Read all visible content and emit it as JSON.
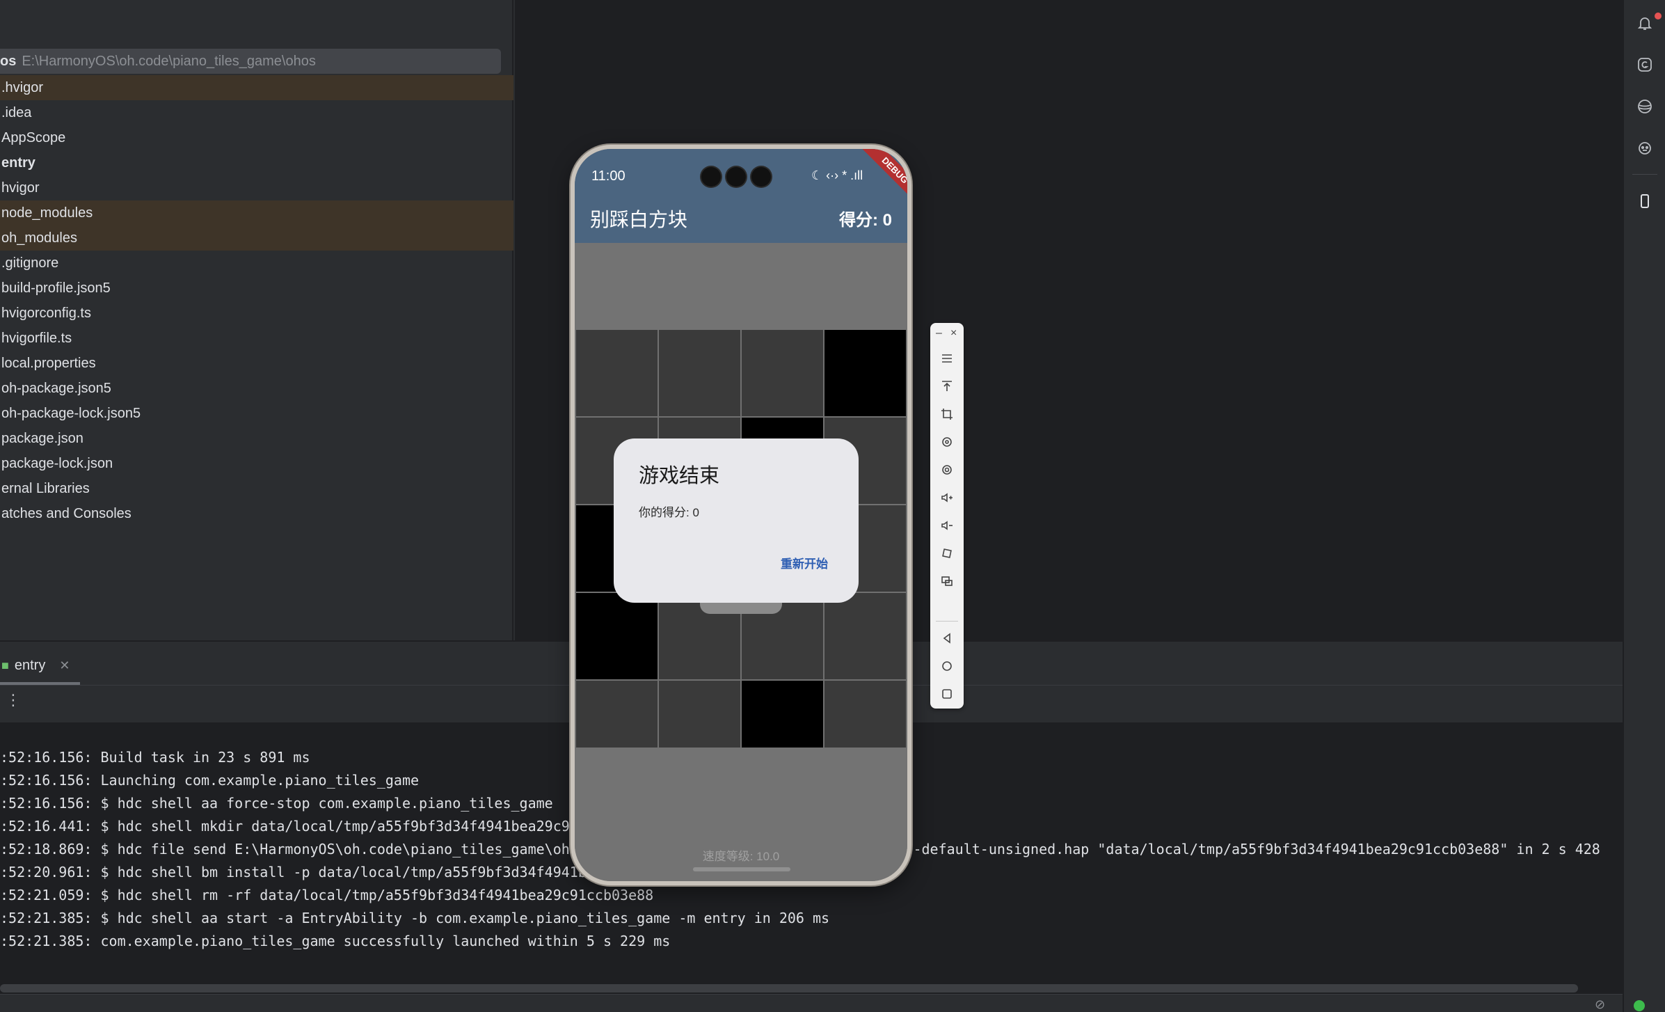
{
  "project": {
    "root_name": "os",
    "root_path": "E:\\HarmonyOS\\oh.code\\piano_tiles_game\\ohos",
    "items": [
      {
        "label": ".hvigor",
        "highlight": true,
        "bold": false
      },
      {
        "label": ".idea",
        "highlight": false,
        "bold": false
      },
      {
        "label": "AppScope",
        "highlight": false,
        "bold": false
      },
      {
        "label": "entry",
        "highlight": false,
        "bold": true
      },
      {
        "label": "hvigor",
        "highlight": false,
        "bold": false
      },
      {
        "label": "node_modules",
        "highlight": true,
        "bold": false
      },
      {
        "label": "oh_modules",
        "highlight": true,
        "bold": false
      },
      {
        "label": ".gitignore",
        "highlight": false,
        "bold": false
      },
      {
        "label": "build-profile.json5",
        "highlight": false,
        "bold": false
      },
      {
        "label": "hvigorconfig.ts",
        "highlight": false,
        "bold": false
      },
      {
        "label": "hvigorfile.ts",
        "highlight": false,
        "bold": false
      },
      {
        "label": "local.properties",
        "highlight": false,
        "bold": false
      },
      {
        "label": "oh-package.json5",
        "highlight": false,
        "bold": false
      },
      {
        "label": "oh-package-lock.json5",
        "highlight": false,
        "bold": false
      },
      {
        "label": "package.json",
        "highlight": false,
        "bold": false
      },
      {
        "label": "package-lock.json",
        "highlight": false,
        "bold": false
      },
      {
        "label": "ernal Libraries",
        "highlight": false,
        "bold": false
      },
      {
        "label": "atches and Consoles",
        "highlight": false,
        "bold": false
      }
    ]
  },
  "run_panel": {
    "tab_label": "entry",
    "more_icon": "⋮",
    "log_lines": [
      ":52:16.156: Build task in 23 s 891 ms",
      ":52:16.156: Launching com.example.piano_tiles_game",
      ":52:16.156: $ hdc shell aa force-stop com.example.piano_tiles_game",
      ":52:16.441: $ hdc shell mkdir data/local/tmp/a55f9bf3d34f4941bea29c91",
      ":52:18.869: $ hdc file send E:\\HarmonyOS\\oh.code\\piano_tiles_game\\oho                                     try-default-unsigned.hap \"data/local/tmp/a55f9bf3d34f4941bea29c91ccb03e88\" in 2 s 428",
      ":52:20.961: $ hdc shell bm install -p data/local/tmp/a55f9bf3d34f4941b",
      ":52:21.059: $ hdc shell rm -rf data/local/tmp/a55f9bf3d34f4941bea29c91ccb03e88",
      ":52:21.385: $ hdc shell aa start -a EntryAbility -b com.example.piano_tiles_game -m entry in 206 ms",
      ":52:21.385: com.example.piano_tiles_game successfully launched within 5 s 229 ms"
    ]
  },
  "phone": {
    "time": "11:00",
    "status_icons": "☾ ‹·› * .ıll",
    "debug_ribbon": "DEBUG",
    "app_title": "别踩白方块",
    "score_label": "得分: 0",
    "speed_label": "速度等级: 10.0",
    "grid": [
      [
        0,
        0,
        0,
        1
      ],
      [
        0,
        0,
        1,
        0
      ],
      [
        1,
        0,
        0,
        0
      ],
      [
        1,
        0,
        0,
        0
      ],
      [
        0,
        0,
        1,
        0
      ]
    ]
  },
  "dialog": {
    "title": "游戏结束",
    "message": "你的得分: 0",
    "button": "重新开始"
  },
  "emulator_toolbar": {
    "minimize": "–",
    "close": "×",
    "buttons": [
      "menu-icon",
      "pin-top-icon",
      "crop-icon",
      "rotate-icon",
      "location-icon",
      "volume-up-icon",
      "volume-down-icon",
      "fold-icon",
      "multi-screen-icon"
    ],
    "nav_buttons": [
      "back-icon",
      "home-icon",
      "recent-icon"
    ]
  },
  "colors": {
    "header": "#4b6580",
    "dialog_button": "#2f5fb3",
    "debug_ribbon": "#b33030"
  }
}
